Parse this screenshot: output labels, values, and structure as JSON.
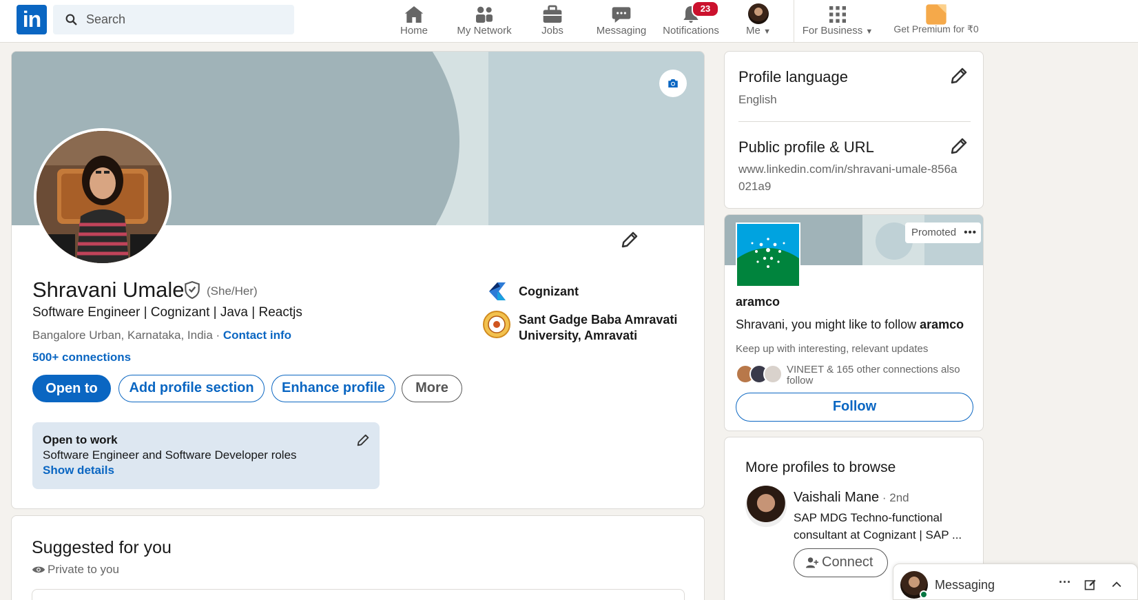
{
  "nav": {
    "logo": "in",
    "search_placeholder": "Search",
    "items": [
      {
        "label": "Home",
        "icon": "home-icon"
      },
      {
        "label": "My Network",
        "icon": "people-icon"
      },
      {
        "label": "Jobs",
        "icon": "briefcase-icon"
      },
      {
        "label": "Messaging",
        "icon": "chat-icon"
      },
      {
        "label": "Notifications",
        "icon": "bell-icon",
        "badge": "23"
      },
      {
        "label": "Me",
        "icon": "avatar"
      },
      {
        "label": "For Business",
        "icon": "grid-icon"
      },
      {
        "label": "Get Premium for ₹0",
        "icon": "premium-icon"
      }
    ]
  },
  "profile": {
    "name": "Shravani Umale",
    "pronouns": "(She/Her)",
    "headline": "Software Engineer | Cognizant | Java | Reactjs",
    "location": "Bangalore Urban, Karnataka, India · ",
    "contact_info": "Contact info",
    "connections": "500+ connections",
    "buttons": {
      "open_to": "Open to",
      "add_section": "Add profile section",
      "enhance": "Enhance profile",
      "more": "More"
    },
    "company": "Cognizant",
    "education": "Sant Gadge Baba Amravati University, Amravati",
    "open_to_work": {
      "title": "Open to work",
      "roles": "Software Engineer and Software Developer roles",
      "link": "Show details"
    }
  },
  "suggested": {
    "title": "Suggested for you",
    "privacy": "Private to you"
  },
  "sidebar": {
    "profile_language": {
      "title": "Profile language",
      "value": "English"
    },
    "public_profile": {
      "title": "Public profile & URL",
      "value": "www.linkedin.com/in/shravani-umale-856a021a9"
    },
    "ad": {
      "promoted": "Promoted",
      "company": "aramco",
      "pitch_prefix": "Shravani, you might like to follow ",
      "pitch_company": "aramco",
      "tagline": "Keep up with interesting, relevant updates",
      "connections": "VINEET & 165 other connections also follow",
      "follow": "Follow"
    },
    "browse": {
      "title": "More profiles to browse",
      "person_name": "Vaishali Mane",
      "degree": " · 2nd",
      "person_desc": "SAP MDG Techno-functional consultant at Cognizant | SAP ...",
      "connect": "Connect"
    }
  },
  "messaging": {
    "label": "Messaging"
  },
  "colors": {
    "brand": "#0a66c2",
    "badge": "#cb112d",
    "online": "#057642"
  }
}
